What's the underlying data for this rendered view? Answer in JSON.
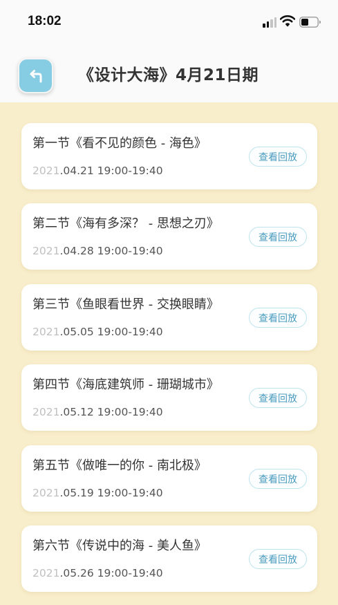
{
  "status_bar": {
    "time": "18:02"
  },
  "header": {
    "title": "《设计大海》4月21日期"
  },
  "lessons": [
    {
      "title": "第一节《看不见的颜色 - 海色》",
      "year_prefix": "2021",
      "time_rest": ".04.21 19:00-19:40",
      "button": "查看回放"
    },
    {
      "title": "第二节《海有多深？ - 思想之刃》",
      "year_prefix": "2021",
      "time_rest": ".04.28 19:00-19:40",
      "button": "查看回放"
    },
    {
      "title": "第三节《鱼眼看世界 - 交换眼睛》",
      "year_prefix": "2021",
      "time_rest": ".05.05 19:00-19:40",
      "button": "查看回放"
    },
    {
      "title": "第四节《海底建筑师 - 珊瑚城市》",
      "year_prefix": "2021",
      "time_rest": ".05.12 19:00-19:40",
      "button": "查看回放"
    },
    {
      "title": "第五节《做唯一的你 - 南北极》",
      "year_prefix": "2021",
      "time_rest": ".05.19 19:00-19:40",
      "button": "查看回放"
    },
    {
      "title": "第六节《传说中的海 - 美人鱼》",
      "year_prefix": "2021",
      "time_rest": ".05.26 19:00-19:40",
      "button": "查看回放"
    }
  ],
  "colors": {
    "background": "#f9eecb",
    "accent": "#86cde3",
    "button_text": "#4a9cc0"
  },
  "icons": {
    "back": "back-arrow-icon",
    "signal": "cellular-signal-icon",
    "wifi": "wifi-icon",
    "battery": "battery-icon"
  }
}
